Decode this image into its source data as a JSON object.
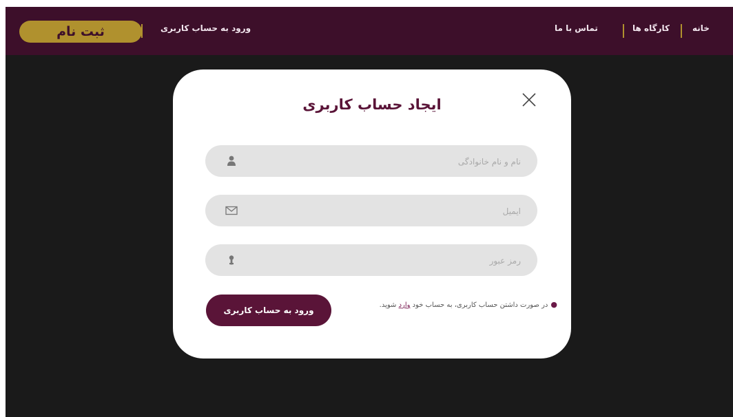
{
  "navbar": {
    "signup_label": "ثبت نام",
    "login_link": "ورود به حساب کاربری",
    "links": [
      "خانه",
      "کارگاه ها",
      "تماس با ما"
    ]
  },
  "modal": {
    "title": "ایجاد حساب کاربری",
    "fields": [
      {
        "placeholder": "نام و نام خانوادگی",
        "value": "",
        "icon": "user-icon"
      },
      {
        "placeholder": "ایمیل",
        "value": "",
        "icon": "mail-icon"
      },
      {
        "placeholder": "رمز عبور",
        "value": "",
        "icon": "key-icon"
      }
    ],
    "note_before": "در صورت داشتن حساب کاربری، به حساب خود ",
    "note_link": "وارد",
    "note_after": " شوید.",
    "login_button": "ورود به حساب کاربری"
  },
  "colors": {
    "navbar": "#3d0f2a",
    "accent_gold": "#b0912e",
    "primary_button": "#5a1438",
    "backdrop": "#1a1a1a",
    "field_background": "#e3e3e3"
  }
}
